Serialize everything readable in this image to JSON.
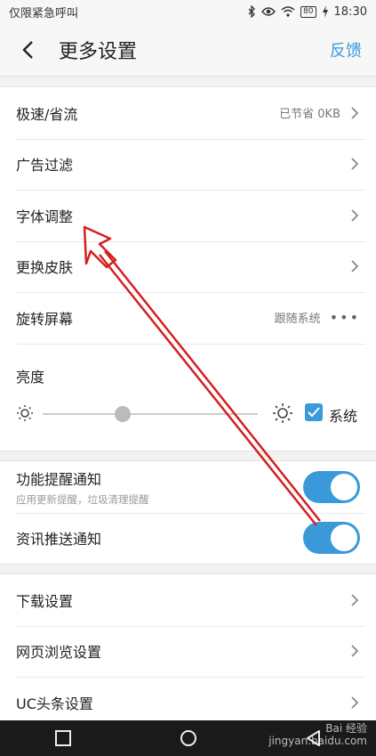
{
  "status_bar": {
    "left_text": "仅限紧急呼叫",
    "battery": "80",
    "time": "18:30",
    "icons": [
      "bluetooth-icon",
      "eye-icon",
      "wifi-icon",
      "battery-icon",
      "charging-icon"
    ]
  },
  "header": {
    "title": "更多设置",
    "feedback": "反馈",
    "back_icon": "chevron-left-icon"
  },
  "group1": {
    "items": [
      {
        "label": "极速/省流",
        "value": "已节省 0KB"
      },
      {
        "label": "广告过滤",
        "value": ""
      },
      {
        "label": "字体调整",
        "value": ""
      },
      {
        "label": "更换皮肤",
        "value": ""
      },
      {
        "label": "旋转屏幕",
        "value": "跟随系统"
      }
    ],
    "brightness": {
      "label": "亮度",
      "system_label": "系统",
      "system_checked": true,
      "level": 0.37
    }
  },
  "group2": {
    "items": [
      {
        "label": "功能提醒通知",
        "sub": "应用更新提醒，垃圾清理提醒",
        "on": true
      },
      {
        "label": "资讯推送通知",
        "sub": "",
        "on": true
      }
    ]
  },
  "group3": {
    "items": [
      {
        "label": "下载设置"
      },
      {
        "label": "网页浏览设置"
      },
      {
        "label": "UC头条设置"
      }
    ]
  },
  "watermark": {
    "line1": "Bai 经验",
    "line2": "jingyan.baidu.com"
  },
  "colors": {
    "accent": "#3a9ad9",
    "annotation_arrow": "#d42020"
  }
}
